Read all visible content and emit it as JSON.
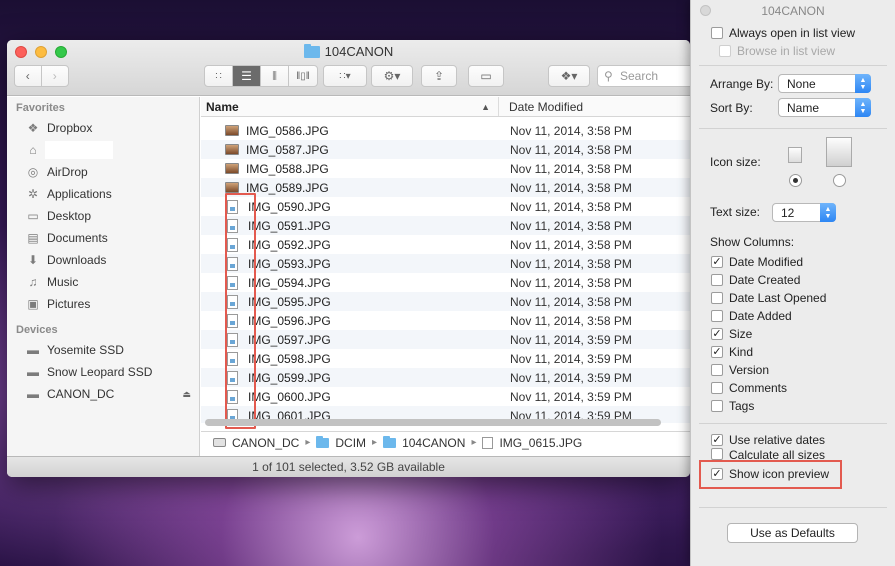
{
  "finder": {
    "title": "104CANON",
    "search_placeholder": "Search",
    "sidebar": {
      "favorites_header": "Favorites",
      "favorites": [
        {
          "label": "Dropbox",
          "icon": "dropbox-icon"
        },
        {
          "label": "",
          "icon": "home-icon"
        },
        {
          "label": "AirDrop",
          "icon": "airdrop-icon"
        },
        {
          "label": "Applications",
          "icon": "applications-icon"
        },
        {
          "label": "Desktop",
          "icon": "desktop-icon"
        },
        {
          "label": "Documents",
          "icon": "documents-icon"
        },
        {
          "label": "Downloads",
          "icon": "downloads-icon"
        },
        {
          "label": "Music",
          "icon": "music-icon"
        },
        {
          "label": "Pictures",
          "icon": "pictures-icon"
        }
      ],
      "devices_header": "Devices",
      "devices": [
        {
          "label": "Yosemite SSD",
          "icon": "drive-icon"
        },
        {
          "label": "Snow Leopard SSD",
          "icon": "drive-icon"
        },
        {
          "label": "CANON_DC",
          "icon": "drive-icon"
        }
      ]
    },
    "columns": {
      "name": "Name",
      "date_modified": "Date Modified"
    },
    "files": [
      {
        "name": "IMG_0586.JPG",
        "date": "Nov 11, 2014, 3:58 PM",
        "thumb": true
      },
      {
        "name": "IMG_0587.JPG",
        "date": "Nov 11, 2014, 3:58 PM",
        "thumb": true
      },
      {
        "name": "IMG_0588.JPG",
        "date": "Nov 11, 2014, 3:58 PM",
        "thumb": true
      },
      {
        "name": "IMG_0589.JPG",
        "date": "Nov 11, 2014, 3:58 PM",
        "thumb": true
      },
      {
        "name": "IMG_0590.JPG",
        "date": "Nov 11, 2014, 3:58 PM",
        "thumb": false
      },
      {
        "name": "IMG_0591.JPG",
        "date": "Nov 11, 2014, 3:58 PM",
        "thumb": false
      },
      {
        "name": "IMG_0592.JPG",
        "date": "Nov 11, 2014, 3:58 PM",
        "thumb": false
      },
      {
        "name": "IMG_0593.JPG",
        "date": "Nov 11, 2014, 3:58 PM",
        "thumb": false
      },
      {
        "name": "IMG_0594.JPG",
        "date": "Nov 11, 2014, 3:58 PM",
        "thumb": false
      },
      {
        "name": "IMG_0595.JPG",
        "date": "Nov 11, 2014, 3:58 PM",
        "thumb": false
      },
      {
        "name": "IMG_0596.JPG",
        "date": "Nov 11, 2014, 3:58 PM",
        "thumb": false
      },
      {
        "name": "IMG_0597.JPG",
        "date": "Nov 11, 2014, 3:59 PM",
        "thumb": false
      },
      {
        "name": "IMG_0598.JPG",
        "date": "Nov 11, 2014, 3:59 PM",
        "thumb": false
      },
      {
        "name": "IMG_0599.JPG",
        "date": "Nov 11, 2014, 3:59 PM",
        "thumb": false
      },
      {
        "name": "IMG_0600.JPG",
        "date": "Nov 11, 2014, 3:59 PM",
        "thumb": false
      },
      {
        "name": "IMG_0601.JPG",
        "date": "Nov 11, 2014, 3:59 PM",
        "thumb": false
      }
    ],
    "path": [
      "CANON_DC",
      "DCIM",
      "104CANON",
      "IMG_0615.JPG"
    ],
    "status": "1 of 101 selected, 3.52 GB available"
  },
  "view_options": {
    "title": "104CANON",
    "always_open_list": {
      "label": "Always open in list view",
      "checked": false
    },
    "browse_list": {
      "label": "Browse in list view",
      "checked": false
    },
    "arrange_by": {
      "label": "Arrange By:",
      "value": "None"
    },
    "sort_by": {
      "label": "Sort By:",
      "value": "Name"
    },
    "icon_size_label": "Icon size:",
    "text_size": {
      "label": "Text size:",
      "value": "12"
    },
    "show_columns_label": "Show Columns:",
    "columns": [
      {
        "label": "Date Modified",
        "checked": true
      },
      {
        "label": "Date Created",
        "checked": false
      },
      {
        "label": "Date Last Opened",
        "checked": false
      },
      {
        "label": "Date Added",
        "checked": false
      },
      {
        "label": "Size",
        "checked": true
      },
      {
        "label": "Kind",
        "checked": true
      },
      {
        "label": "Version",
        "checked": false
      },
      {
        "label": "Comments",
        "checked": false
      },
      {
        "label": "Tags",
        "checked": false
      }
    ],
    "use_relative_dates": {
      "label": "Use relative dates",
      "checked": true
    },
    "calculate_all_sizes": {
      "label": "Calculate all sizes",
      "checked": false
    },
    "show_icon_preview": {
      "label": "Show icon preview",
      "checked": true
    },
    "use_as_defaults": "Use as Defaults"
  },
  "colors": {
    "highlight_box": "#e35a4f",
    "selection_blue": "#2d86f4"
  }
}
